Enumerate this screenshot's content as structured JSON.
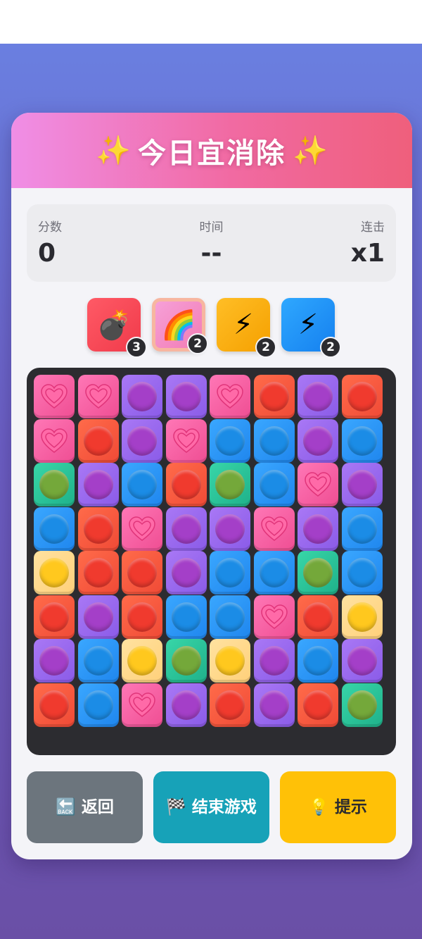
{
  "title": {
    "text": "今日宜消除",
    "sparkle_left": "✨",
    "sparkle_right": "✨"
  },
  "stats": {
    "score_label": "分数",
    "score_value": "0",
    "time_label": "时间",
    "time_value": "--",
    "combo_label": "连击",
    "combo_value": "x1"
  },
  "powerups": [
    {
      "name": "bomb",
      "icon": "💣",
      "count": "3"
    },
    {
      "name": "rainbow",
      "icon": "🌈",
      "count": "2"
    },
    {
      "name": "lightning-orange",
      "icon": "⚡",
      "count": "2"
    },
    {
      "name": "lightning-blue",
      "icon": "⚡",
      "count": "2"
    }
  ],
  "board": [
    [
      "heart",
      "heart",
      "purple",
      "purple",
      "heart",
      "red",
      "purple",
      "red"
    ],
    [
      "heart",
      "red",
      "purple",
      "heart",
      "blue",
      "blue",
      "purple",
      "blue"
    ],
    [
      "green",
      "purple",
      "blue",
      "red",
      "green",
      "blue",
      "heart",
      "purple"
    ],
    [
      "blue",
      "red",
      "heart",
      "purple",
      "purple",
      "heart",
      "purple",
      "blue"
    ],
    [
      "yellow",
      "red",
      "red",
      "purple",
      "blue",
      "blue",
      "green",
      "blue"
    ],
    [
      "red",
      "purple",
      "red",
      "blue",
      "blue",
      "heart",
      "red",
      "yellow"
    ],
    [
      "purple",
      "blue",
      "yellow",
      "green",
      "yellow",
      "purple",
      "blue",
      "purple"
    ],
    [
      "red",
      "blue",
      "heart",
      "purple",
      "red",
      "purple",
      "red",
      "green"
    ]
  ],
  "buttons": {
    "back_icon": "🔙",
    "back_label": "返回",
    "end_icon": "🏁",
    "end_label": "结束游戏",
    "hint_icon": "💡",
    "hint_label": "提示"
  },
  "colors": {
    "background_top": "#6a7fe0",
    "background_bottom": "#6a4fa6",
    "header_gradient_start": "#f08ee6",
    "header_gradient_end": "#ef5f7c",
    "back_button": "#6c757d",
    "end_button": "#17a2b8",
    "hint_button": "#ffc107"
  }
}
